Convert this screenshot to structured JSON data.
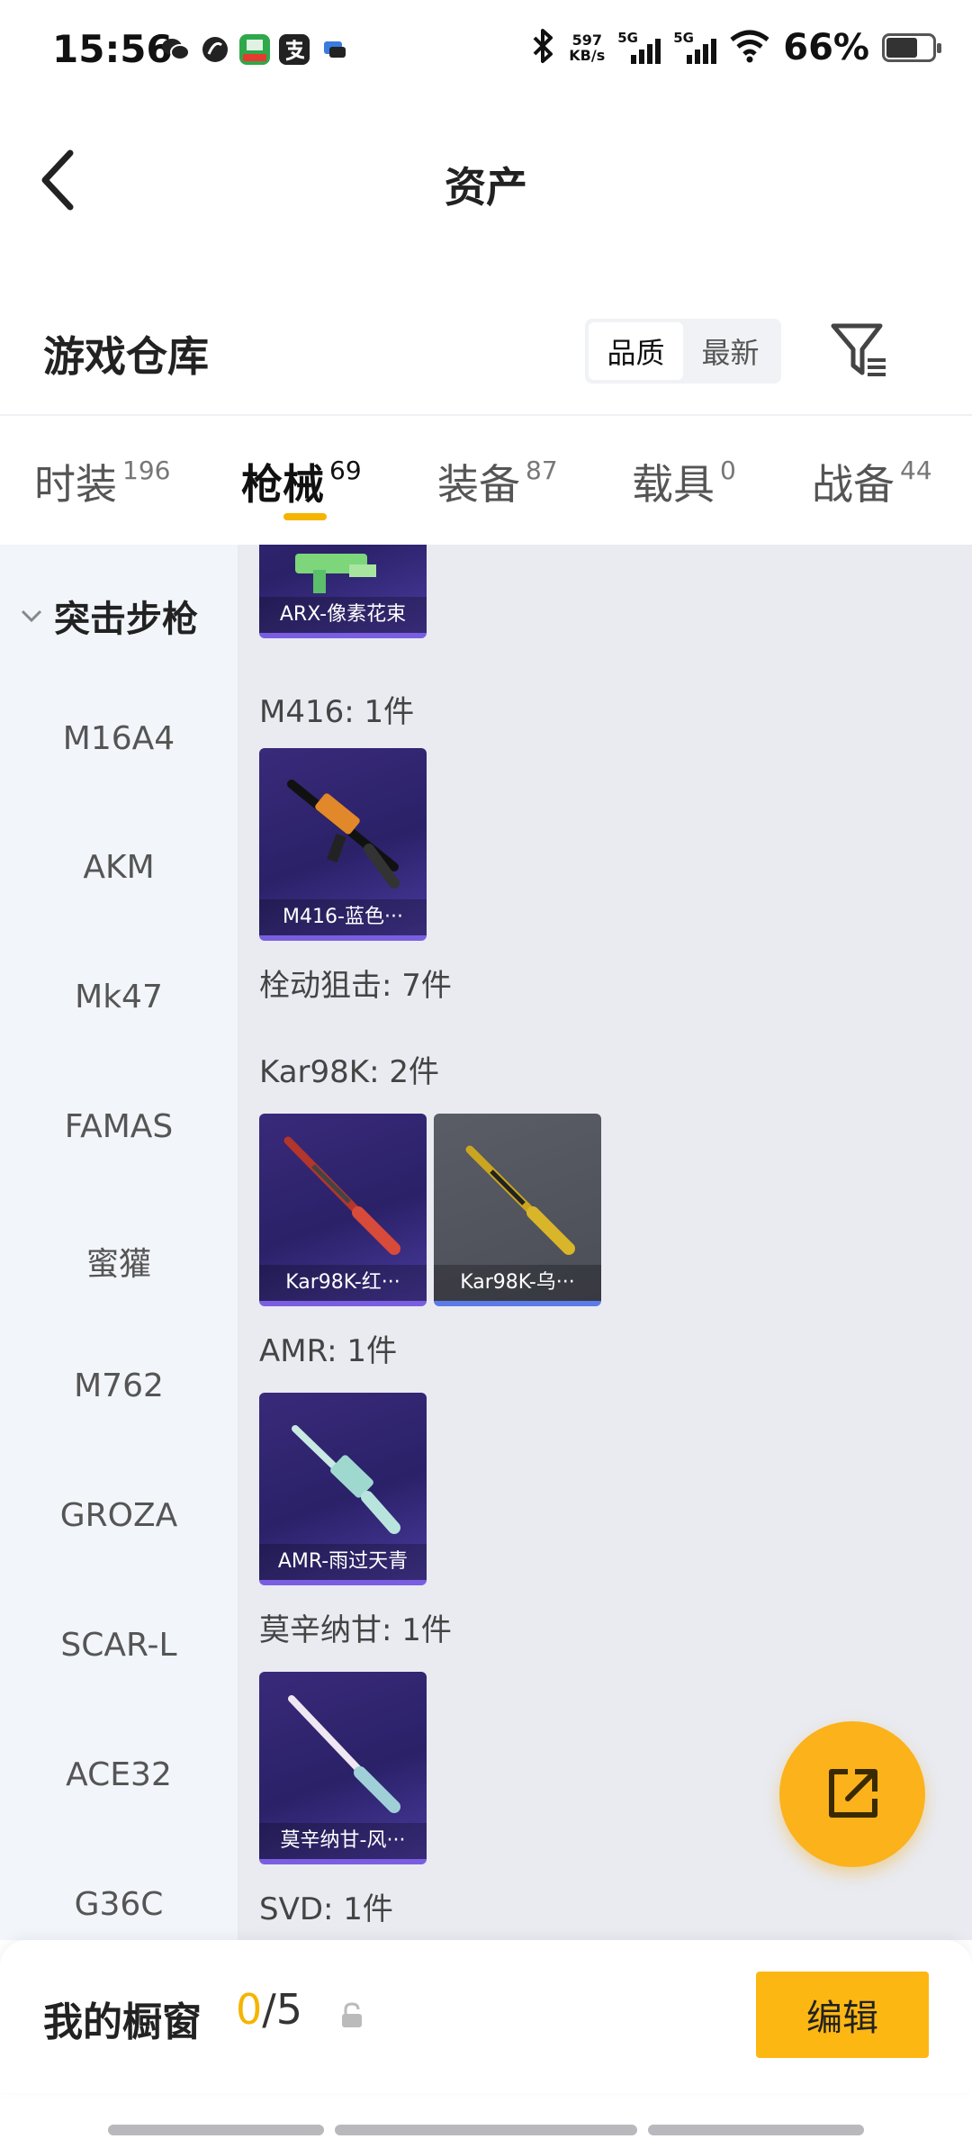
{
  "status_bar": {
    "time": "15:56",
    "net_speed_value": "597",
    "net_speed_unit": "KB/s",
    "sim1_label": "5G",
    "sim2_label": "5G",
    "battery": "66%",
    "app_icons": [
      "wechat-icon",
      "browser-icon",
      "guazi-app-icon",
      "alipay-icon",
      "message-app-icon"
    ]
  },
  "header": {
    "title": "资产"
  },
  "warehouse": {
    "title": "游戏仓库",
    "sort_options": [
      "品质",
      "最新"
    ],
    "active_sort": "品质"
  },
  "tabs": [
    {
      "label": "时装",
      "count": "196"
    },
    {
      "label": "枪械",
      "count": "69"
    },
    {
      "label": "装备",
      "count": "87"
    },
    {
      "label": "载具",
      "count": "0"
    },
    {
      "label": "战备",
      "count": "44"
    }
  ],
  "active_tab": "枪械",
  "categories": {
    "group": "突击步枪",
    "items": [
      "M16A4",
      "AKM",
      "Mk47",
      "FAMAS",
      "蜜獾",
      "M762",
      "GROZA",
      "SCAR-L",
      "ACE32",
      "G36C"
    ]
  },
  "content": {
    "groups": [
      {
        "label": "",
        "items": [
          {
            "name": "ARX-像素花束"
          }
        ]
      },
      {
        "label": "M416: 1件",
        "items": [
          {
            "name": "M416-蓝色···"
          }
        ]
      },
      {
        "label": "栓动狙击: 7件",
        "items": []
      },
      {
        "label": "Kar98K: 2件",
        "items": [
          {
            "name": "Kar98K-红···"
          },
          {
            "name": "Kar98K-乌···"
          }
        ]
      },
      {
        "label": "AMR: 1件",
        "items": [
          {
            "name": "AMR-雨过天青"
          }
        ]
      },
      {
        "label": "莫辛纳甘: 1件",
        "items": [
          {
            "name": "莫辛纳甘-风···"
          }
        ]
      },
      {
        "label": "SVD: 1件",
        "items": []
      }
    ]
  },
  "showcase": {
    "title": "我的橱窗",
    "current": "0",
    "separator": "/",
    "max": "5",
    "edit_label": "编辑"
  },
  "colors": {
    "accent": "#f5b400",
    "fab": "#fbb21b",
    "card_purple": "#2a2168",
    "card_grey": "#4b4d57"
  }
}
